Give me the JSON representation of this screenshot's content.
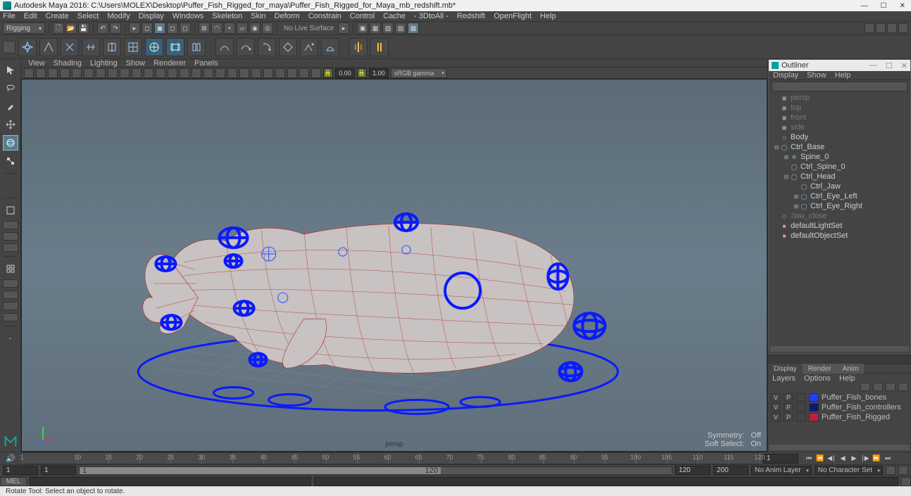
{
  "titlebar": {
    "app": "Autodesk Maya 2016:",
    "filepath": "C:\\Users\\MOLEX\\Desktop\\Puffer_Fish_Rigged_for_maya\\Puffer_Fish_Rigged_for_Maya_mb_redshift.mb*"
  },
  "main_menu": [
    "File",
    "Edit",
    "Create",
    "Select",
    "Modify",
    "Display",
    "Windows",
    "Skeleton",
    "Skin",
    "Deform",
    "Constrain",
    "Control",
    "Cache",
    "- 3DtoAll -",
    "Redshift",
    "OpenFlight",
    "Help"
  ],
  "menu_set": "Rigging",
  "no_live_surface": "No Live Surface",
  "view_menu": [
    "View",
    "Shading",
    "Lighting",
    "Show",
    "Renderer",
    "Panels"
  ],
  "view_toolbar": {
    "near": "0.00",
    "far": "1.00",
    "colorspace": "sRGB gamma"
  },
  "viewport": {
    "camera": "persp",
    "symmetry_label": "Symmetry:",
    "symmetry_value": "Off",
    "softselect_label": "Soft Select:",
    "softselect_value": "On"
  },
  "outliner": {
    "title": "Outliner",
    "menu": [
      "Display",
      "Show",
      "Help"
    ],
    "nodes": [
      {
        "indent": 0,
        "exp": "none",
        "icon": "camera",
        "label": "persp",
        "dim": true
      },
      {
        "indent": 0,
        "exp": "none",
        "icon": "camera",
        "label": "top",
        "dim": true
      },
      {
        "indent": 0,
        "exp": "none",
        "icon": "camera",
        "label": "front",
        "dim": true
      },
      {
        "indent": 0,
        "exp": "none",
        "icon": "camera",
        "label": "side",
        "dim": true
      },
      {
        "indent": 0,
        "exp": "none",
        "icon": "mesh",
        "label": "Body"
      },
      {
        "indent": 0,
        "exp": "minus",
        "icon": "curve",
        "label": "Ctrl_Base"
      },
      {
        "indent": 1,
        "exp": "plus",
        "icon": "joint",
        "label": "Spine_0"
      },
      {
        "indent": 1,
        "exp": "none",
        "icon": "curve",
        "label": "Ctrl_Spine_0"
      },
      {
        "indent": 1,
        "exp": "minus",
        "icon": "curve",
        "label": "Ctrl_Head"
      },
      {
        "indent": 2,
        "exp": "none",
        "icon": "curve",
        "label": "Ctrl_Jaw"
      },
      {
        "indent": 2,
        "exp": "plus",
        "icon": "curve",
        "label": "Ctrl_Eye_Left"
      },
      {
        "indent": 2,
        "exp": "plus",
        "icon": "curve",
        "label": "Ctrl_Eye_Right"
      },
      {
        "indent": 0,
        "exp": "none",
        "icon": "mesh",
        "label": "Jaw_close",
        "dim": true
      },
      {
        "indent": 0,
        "exp": "none",
        "icon": "set",
        "label": "defaultLightSet"
      },
      {
        "indent": 0,
        "exp": "none",
        "icon": "set",
        "label": "defaultObjectSet"
      }
    ]
  },
  "channelbox": {
    "tabs": [
      "Display",
      "Render",
      "Anim"
    ],
    "active_tab": "Display",
    "layer_menu": [
      "Layers",
      "Options",
      "Help"
    ],
    "layers": [
      {
        "v": "V",
        "p": "P",
        "color": "#1a3fff",
        "name": "Puffer_Fish_bones"
      },
      {
        "v": "V",
        "p": "P",
        "color": "#0a1a6f",
        "name": "Puffer_Fish_controllers"
      },
      {
        "v": "V",
        "p": "P",
        "color": "#c21f3a",
        "name": "Puffer_Fish_Rigged"
      }
    ]
  },
  "timeslider": {
    "ticks": [
      1,
      10,
      15,
      20,
      25,
      30,
      35,
      40,
      45,
      50,
      55,
      60,
      65,
      70,
      75,
      80,
      85,
      90,
      95,
      100,
      105,
      110,
      115,
      120
    ],
    "current": "1"
  },
  "range": {
    "start_inner": "1",
    "start_outer": "1",
    "end_inner": "120",
    "end_outer": "200",
    "range_label_left": "1",
    "range_label_right": "120",
    "anim_layer": "No Anim Layer",
    "char_set": "No Character Set"
  },
  "cmdline": {
    "lang": "MEL"
  },
  "helpline": "Rotate Tool: Select an object to rotate."
}
